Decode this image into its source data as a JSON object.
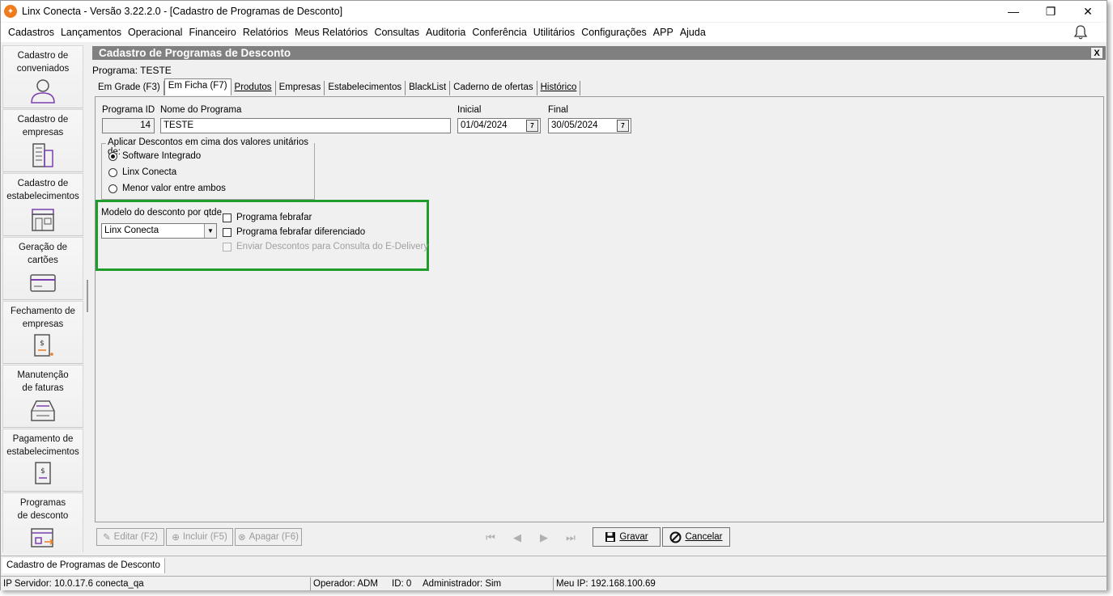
{
  "window": {
    "title": "Linx Conecta - Versão 3.22.2.0 - [Cadastro de Programas de Desconto]",
    "minimize": "—",
    "restore": "❐",
    "close": "✕"
  },
  "menu": [
    "Cadastros",
    "Lançamentos",
    "Operacional",
    "Financeiro",
    "Relatórios",
    "Meus Relatórios",
    "Consultas",
    "Auditoria",
    "Conferência",
    "Utilitários",
    "Configurações",
    "APP",
    "Ajuda"
  ],
  "sidebar": {
    "items": [
      {
        "label1": "Cadastro de",
        "label2": "conveniados",
        "icon": "user-icon"
      },
      {
        "label1": "Cadastro de",
        "label2": "empresas",
        "icon": "building-icon"
      },
      {
        "label1": "Cadastro de",
        "label2": "estabelecimentos",
        "icon": "store-icon"
      },
      {
        "label1": "Geração de",
        "label2": "cartões",
        "icon": "card-icon"
      },
      {
        "label1": "Fechamento de",
        "label2": "empresas",
        "icon": "invoice-icon"
      },
      {
        "label1": "Manutenção",
        "label2": "de faturas",
        "icon": "tray-icon"
      },
      {
        "label1": "Pagamento de",
        "label2": "estabelecimentos",
        "icon": "payment-icon"
      },
      {
        "label1": "Programas",
        "label2": "de desconto",
        "icon": "discount-icon"
      }
    ]
  },
  "form": {
    "header": "Cadastro de Programas de Desconto",
    "close": "X",
    "program_label": "Programa: TESTE",
    "tabs": [
      {
        "label": "Em Grade (F3)",
        "active": false
      },
      {
        "label": "Em Ficha (F7)",
        "active": true
      },
      {
        "label": "Produtos",
        "active": false
      },
      {
        "label": "Empresas",
        "active": false
      },
      {
        "label": "Estabelecimentos",
        "active": false
      },
      {
        "label": "BlackList",
        "active": false
      },
      {
        "label": "Caderno de ofertas",
        "active": false
      },
      {
        "label": "Histórico",
        "active": false
      }
    ],
    "fields": {
      "id_label": "Programa ID",
      "id_value": "14",
      "name_label": "Nome do Programa",
      "name_value": "TESTE",
      "start_label": "Inicial",
      "start_value": "01/04/2024",
      "end_label": "Final",
      "end_value": "30/05/2024",
      "cal_glyph": "7"
    },
    "discount_group": {
      "title": "Aplicar Descontos em cima dos valores unitários de:",
      "options": [
        "Software Integrado",
        "Linx Conecta",
        "Menor valor entre ambos"
      ],
      "selected": 0
    },
    "model": {
      "label": "Modelo do desconto por qtde",
      "value": "Linx Conecta",
      "dropdown_glyph": "▼"
    },
    "checkboxes": [
      {
        "label": "Programa febrafar",
        "checked": false,
        "disabled": false
      },
      {
        "label": "Programa febrafar diferenciado",
        "checked": false,
        "disabled": false
      },
      {
        "label": "Enviar Descontos para Consulta do E-Delivery",
        "checked": false,
        "disabled": true
      }
    ],
    "highlight_color": "#1f9c2c"
  },
  "toolbar": {
    "edit": "Editar (F2)",
    "include": "Incluir (F5)",
    "delete": "Apagar (F6)",
    "save": "Gravar",
    "cancel": "Cancelar",
    "nav_first": "⏮",
    "nav_prev": "◀",
    "nav_next": "▶",
    "nav_last": "⏭"
  },
  "status": {
    "open_form": "Cadastro de Programas de Desconto",
    "server": "IP Servidor: 10.0.17.6 conecta_qa",
    "operator": "Operador: ADM",
    "id": "ID: 0",
    "admin": "Administrador: Sim",
    "ip": "Meu IP: 192.168.100.69"
  }
}
